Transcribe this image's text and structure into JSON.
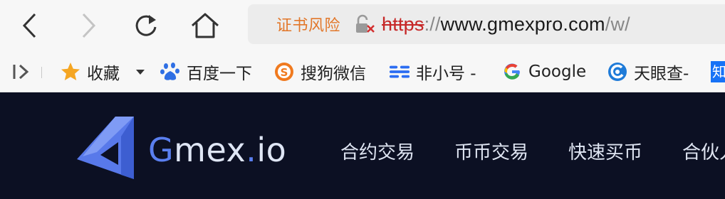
{
  "browser": {
    "back_icon": "chevron-left-icon",
    "forward_icon": "chevron-right-icon",
    "reload_icon": "reload-icon",
    "home_icon": "home-icon",
    "address": {
      "cert_warning": "证书风险",
      "lock_icon": "broken-lock-icon",
      "scheme": "https",
      "separator": "://",
      "host": "www.gmexpro.com",
      "path": "/w/"
    }
  },
  "bookmarks": {
    "sidebar_toggle_icon": "sidebar-toggle-icon",
    "items": [
      {
        "label": "收藏",
        "icon": "star-icon"
      },
      {
        "label": "百度一下",
        "icon": "baidu-paw-icon"
      },
      {
        "label": "搜狗微信",
        "icon": "sogou-icon"
      },
      {
        "label": "非小号 -",
        "icon": "feixiaohao-icon"
      },
      {
        "label": "Google",
        "icon": "google-icon"
      },
      {
        "label": "天眼查-",
        "icon": "tianyancha-icon"
      },
      {
        "label": "知",
        "icon": "zhihu-icon"
      }
    ]
  },
  "site": {
    "logo_mark_icon": "gmex-logo-icon",
    "logo": {
      "g": "G",
      "mex": "mex",
      "dot": ".",
      "io": "io"
    },
    "nav": [
      {
        "label": "合约交易"
      },
      {
        "label": "币币交易"
      },
      {
        "label": "快速买币"
      },
      {
        "label": "合伙人"
      }
    ]
  },
  "colors": {
    "cert_warning": "#e2772a",
    "scheme_strike": "#c62828",
    "site_bg": "#0c1023",
    "brand_blue": "#5a7ff0"
  }
}
